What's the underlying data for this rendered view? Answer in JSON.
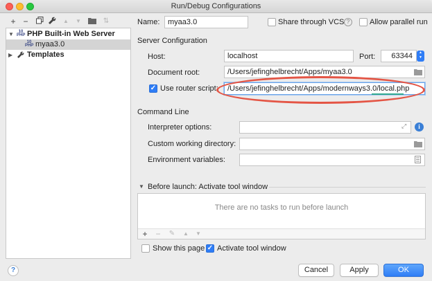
{
  "window": {
    "title": "Run/Debug Configurations"
  },
  "colors": {
    "accent": "#2f7df6",
    "highlight_ellipse": "#e45545"
  },
  "toolbar": {
    "add": "+",
    "remove": "−",
    "copy": "⧉",
    "edit": "🔧",
    "up": "▲",
    "down": "▼",
    "folder": "📁",
    "sort": "⇅"
  },
  "tree": {
    "items": [
      {
        "label": "PHP Built-in Web Server",
        "icon": "php-icon",
        "expanded": true
      },
      {
        "label": "myaa3.0",
        "icon": "php-icon",
        "selected": true
      },
      {
        "label": "Templates",
        "icon": "wrench-icon",
        "expanded": false
      }
    ]
  },
  "form": {
    "name_label": "Name:",
    "name_value": "myaa3.0",
    "share_vcs_label": "Share through VCS",
    "share_vcs_checked": false,
    "allow_parallel_label": "Allow parallel run",
    "allow_parallel_checked": false,
    "server_config_section": "Server Configuration",
    "host_label": "Host:",
    "host_value": "localhost",
    "port_label": "Port:",
    "port_value": "63344",
    "docroot_label": "Document root:",
    "docroot_value": "/Users/jefinghelbrecht/Apps/myaa3.0",
    "router_label": "Use router script:",
    "router_checked": true,
    "router_value": "/Users/jefinghelbrecht/Apps/modernways3.0/local.php",
    "command_line_section": "Command Line",
    "interpreter_label": "Interpreter options:",
    "interpreter_value": "",
    "workdir_label": "Custom working directory:",
    "workdir_value": "",
    "envvars_label": "Environment variables:",
    "envvars_value": "",
    "before_launch_section": "Before launch: Activate tool window",
    "tasks_empty": "There are no tasks to run before launch",
    "show_page_label": "Show this page",
    "show_page_checked": false,
    "activate_tool_label": "Activate tool window",
    "activate_tool_checked": true
  },
  "buttons": {
    "help": "?",
    "cancel": "Cancel",
    "apply": "Apply",
    "ok": "OK"
  }
}
